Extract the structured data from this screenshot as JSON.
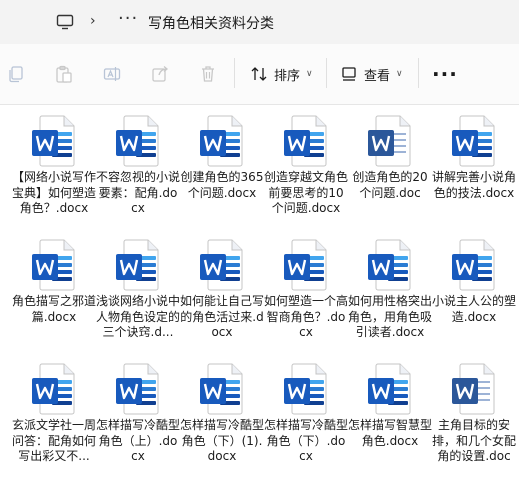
{
  "address_bar": {
    "location_icon": "computer-icon",
    "overflow": "···",
    "title": "写角色相关资料分类"
  },
  "toolbar": {
    "sort_label": "排序",
    "view_label": "查看",
    "more_label": "···"
  },
  "files": [
    {
      "name": "【网络小说写作宝典】如何塑造角色？.docx",
      "icon": "word-doc-icon"
    },
    {
      "name": "不容忽视的小说要素：配角.docx",
      "icon": "word-doc-icon"
    },
    {
      "name": "创建角色的365个问题.docx",
      "icon": "word-doc-icon"
    },
    {
      "name": "创造穿越文角色前要思考的10个问题.docx",
      "icon": "word-doc-icon"
    },
    {
      "name": "创造角色的20个问题.doc",
      "icon": "word-legacy-doc-icon"
    },
    {
      "name": "讲解完善小说角色的技法.docx",
      "icon": "word-doc-icon"
    },
    {
      "name": "角色描写之邪道篇.docx",
      "icon": "word-doc-icon"
    },
    {
      "name": "浅谈网络小说中人物角色设定的三个诀窍.d...",
      "icon": "word-doc-icon"
    },
    {
      "name": "如何能让自己写的角色活过来.docx",
      "icon": "word-doc-icon"
    },
    {
      "name": "如何塑造一个高智商角色？.docx",
      "icon": "word-doc-icon"
    },
    {
      "name": "如何用性格突出角色，用角色吸引读者.docx",
      "icon": "word-doc-icon"
    },
    {
      "name": "小说主人公的塑造.docx",
      "icon": "word-doc-icon"
    },
    {
      "name": "玄派文学社一周问答：配角如何写出彩又不...",
      "icon": "word-doc-icon"
    },
    {
      "name": "怎样描写冷酷型角色（上）.docx",
      "icon": "word-doc-icon"
    },
    {
      "name": "怎样描写冷酷型角色（下）(1).docx",
      "icon": "word-doc-icon"
    },
    {
      "name": "怎样描写冷酷型角色（下）.docx",
      "icon": "word-doc-icon"
    },
    {
      "name": "怎样描写智慧型角色.docx",
      "icon": "word-doc-icon"
    },
    {
      "name": "主角目标的安排，和几个女配角的设置.doc",
      "icon": "word-legacy-doc-icon"
    }
  ],
  "colors": {
    "word_blue": "#185abd",
    "word_legacy_blue": "#2b579a",
    "addressbar_bg": "#f3f3f3"
  }
}
